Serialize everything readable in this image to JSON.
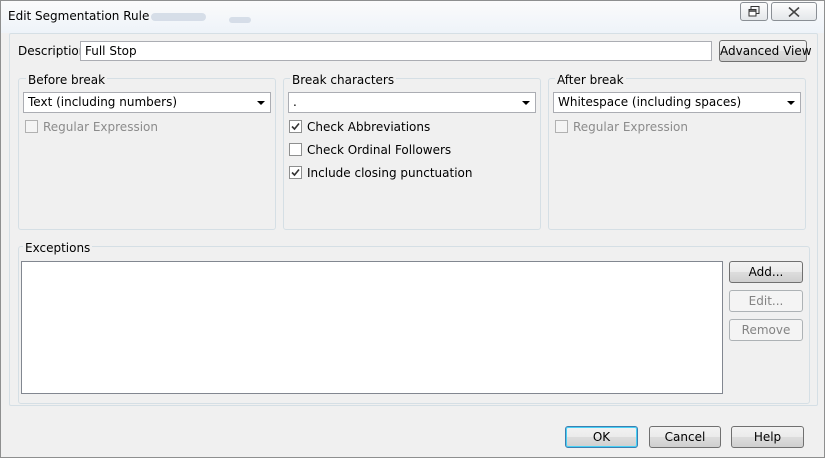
{
  "window": {
    "title": "Edit Segmentation Rule"
  },
  "description": {
    "label": "Description",
    "value": "Full Stop",
    "advanced_view_label": "Advanced View"
  },
  "before_break": {
    "label": "Before break",
    "selected": "Text (including numbers)",
    "regex_label": "Regular Expression",
    "regex_checked": false,
    "regex_enabled": false
  },
  "break_characters": {
    "label": "Break characters",
    "selected": ".",
    "options": [
      {
        "label": "Check Abbreviations",
        "checked": true
      },
      {
        "label": "Check Ordinal Followers",
        "checked": false
      },
      {
        "label": "Include closing punctuation",
        "checked": true
      }
    ]
  },
  "after_break": {
    "label": "After break",
    "selected": "Whitespace (including spaces)",
    "regex_label": "Regular Expression",
    "regex_checked": false,
    "regex_enabled": false
  },
  "exceptions": {
    "label": "Exceptions",
    "add_label": "Add...",
    "edit_label": "Edit...",
    "remove_label": "Remove",
    "items": []
  },
  "footer": {
    "ok_label": "OK",
    "cancel_label": "Cancel",
    "help_label": "Help"
  },
  "icons": {
    "restore": "restore-icon",
    "close": "close-icon",
    "dropdown": "chevron-down-icon",
    "check": "checkmark-icon"
  }
}
